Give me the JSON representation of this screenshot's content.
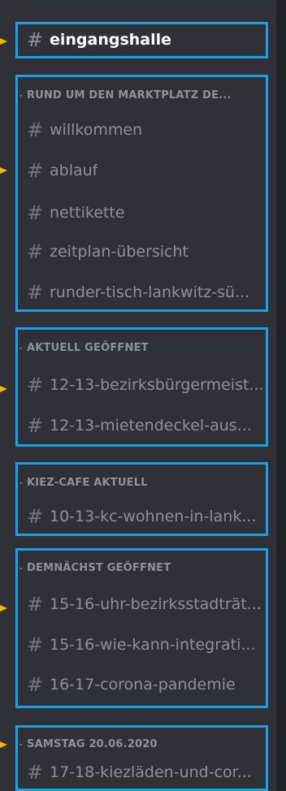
{
  "selected_channel": {
    "name": "eingangshalle"
  },
  "categories": [
    {
      "name": "RUND UM DEN MARKTPLATZ DE...",
      "channels": [
        "willkommen",
        "ablauf",
        "nettikette",
        "zeitplan-übersicht",
        "runder-tisch-lankwitz-sü..."
      ]
    },
    {
      "name": "AKTUELL GEÖFFNET",
      "channels": [
        "12-13-bezirksbürgermeist...",
        "12-13-mietendeckel-aus..."
      ]
    },
    {
      "name": "KIEZ-CAFE AKTUELL",
      "channels": [
        "10-13-kc-wohnen-in-lank..."
      ]
    },
    {
      "name": "DEMNÄCHST GEÖFFNET",
      "channels": [
        "15-16-uhr-bezirksstadträt...",
        "15-16-wie-kann-integrati...",
        "16-17-corona-pandemie"
      ]
    },
    {
      "name": "SAMSTAG 20.06.2020",
      "channels": [
        "17-18-kiezläden-und-cor..."
      ]
    }
  ],
  "icons": {
    "channel": "hash-icon",
    "category_toggle": "chevron-down-icon",
    "annotation_pointer": "arrow-pointer-icon"
  },
  "colors": {
    "background": "#2f3136",
    "highlight_border": "#1aa0e6",
    "pointer": "#f0b800",
    "channel_text": "#8e9297",
    "selected_text": "#ffffff"
  }
}
